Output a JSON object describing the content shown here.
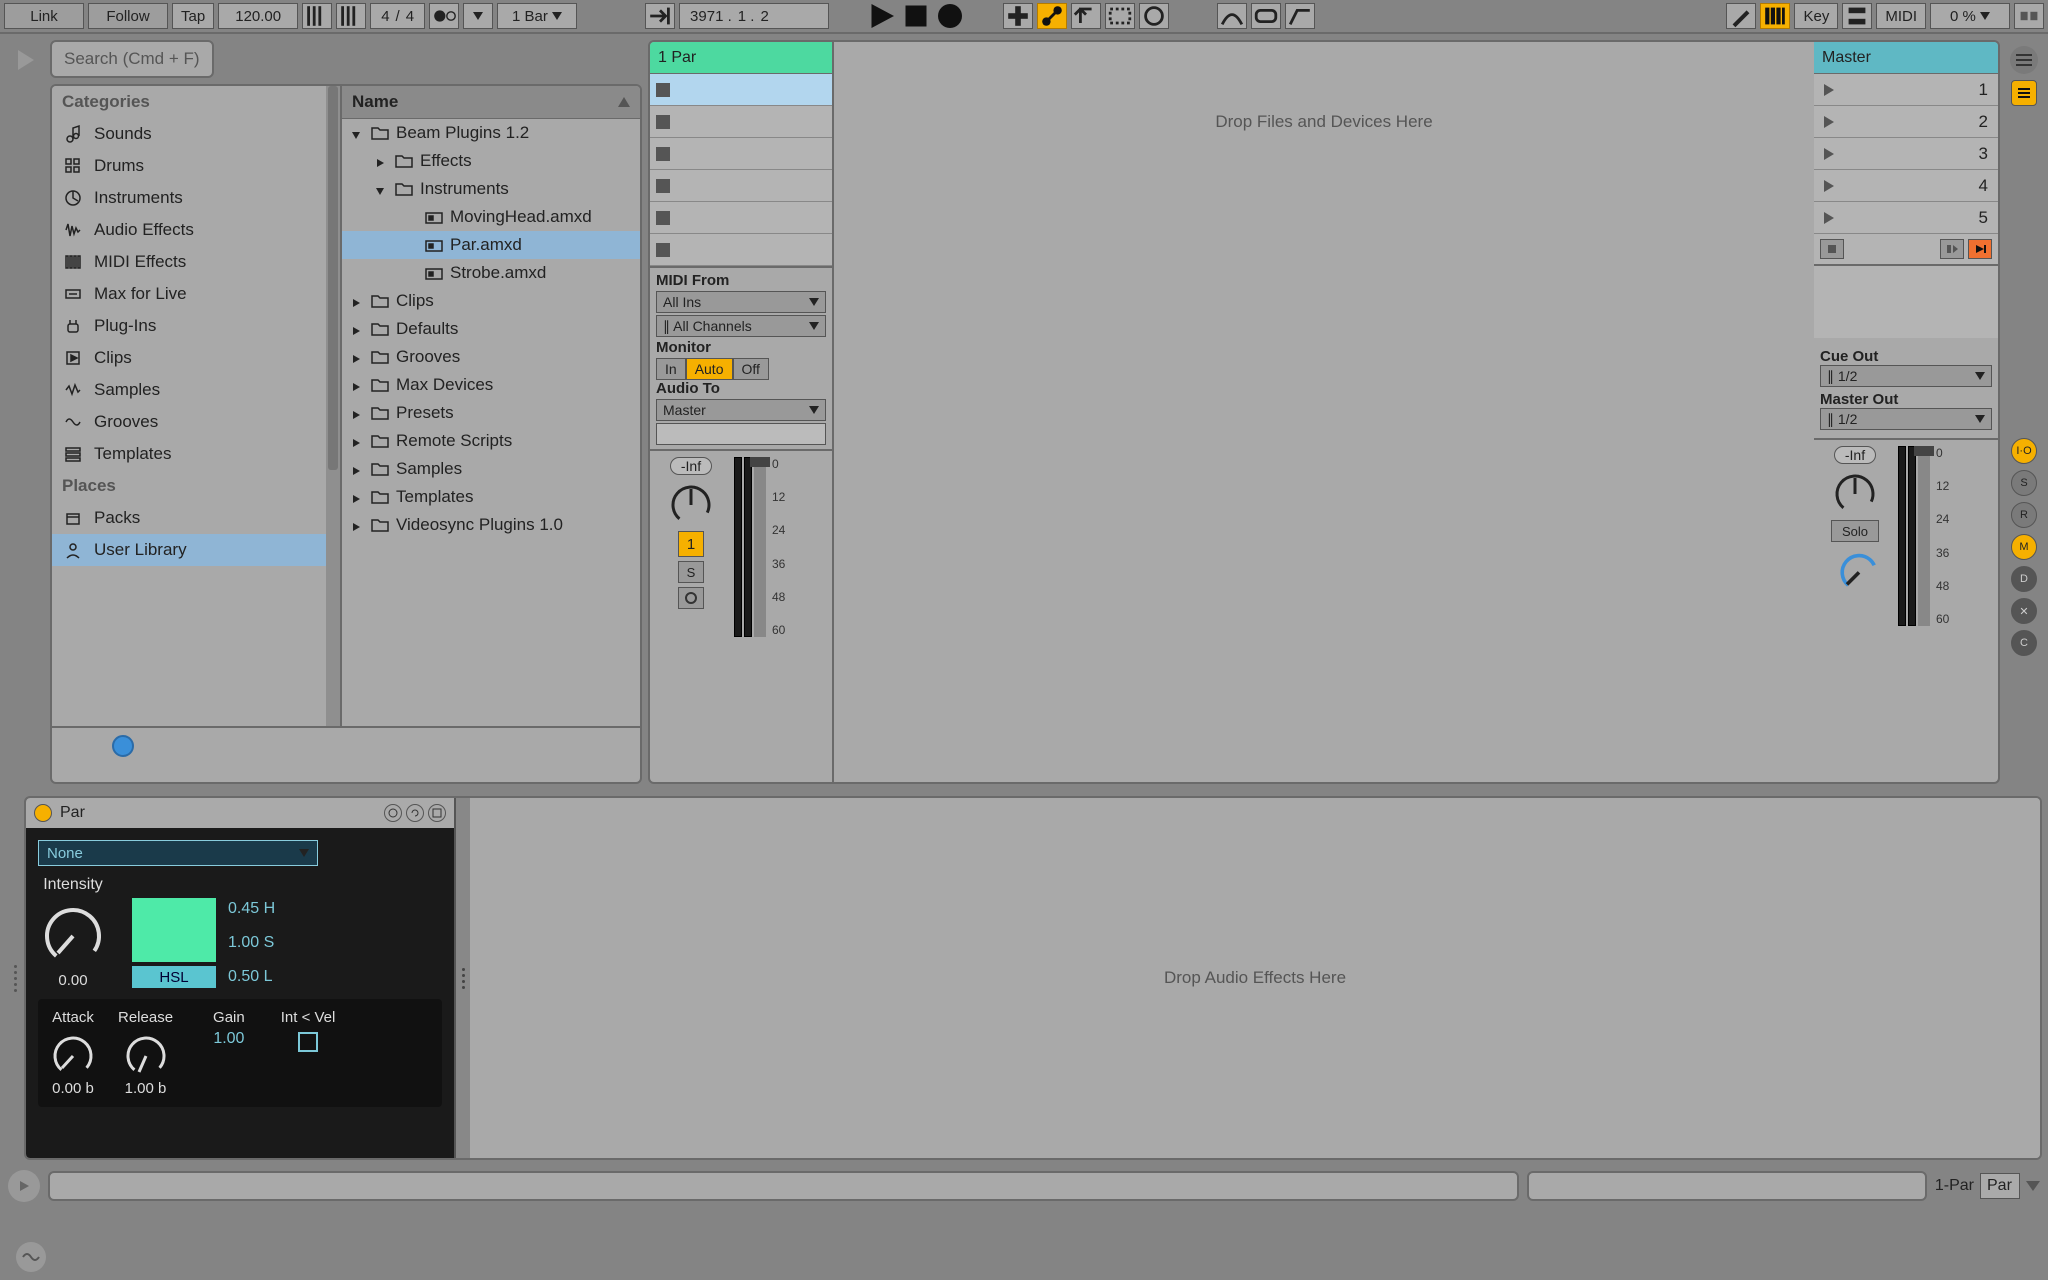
{
  "toolbar": {
    "link": "Link",
    "follow": "Follow",
    "tap": "Tap",
    "tempo": "120.00",
    "sig_num": "4",
    "sig_den": "4",
    "quantize": "1 Bar",
    "pos_bars": "3971 .",
    "pos_beats": "1 .",
    "pos_sixteenths": "2",
    "key": "Key",
    "midi": "MIDI",
    "cpu": "0 %"
  },
  "browser": {
    "search_placeholder": "Search (Cmd + F)",
    "cat_header": "Categories",
    "places_header": "Places",
    "categories": [
      "Sounds",
      "Drums",
      "Instruments",
      "Audio Effects",
      "MIDI Effects",
      "Max for Live",
      "Plug-Ins",
      "Clips",
      "Samples",
      "Grooves",
      "Templates"
    ],
    "places": [
      "Packs",
      "User Library"
    ],
    "name_header": "Name",
    "tree": {
      "root": "Beam Plugins 1.2",
      "effects": "Effects",
      "instruments": "Instruments",
      "inst_items": [
        "MovingHead.amxd",
        "Par.amxd",
        "Strobe.amxd"
      ],
      "folders": [
        "Clips",
        "Defaults",
        "Grooves",
        "Max Devices",
        "Presets",
        "Remote Scripts",
        "Samples",
        "Templates",
        "Videosync Plugins 1.0"
      ]
    }
  },
  "session": {
    "track_name": "1 Par",
    "drop_hint": "Drop Files and Devices Here",
    "midi_from": "MIDI From",
    "all_ins": "All Ins",
    "all_channels": "All Channels",
    "monitor": "Monitor",
    "mon_in": "In",
    "mon_auto": "Auto",
    "mon_off": "Off",
    "audio_to": "Audio To",
    "audio_to_val": "Master",
    "track_vol": "-Inf",
    "track_num": "1",
    "solo": "S",
    "scale": [
      "0",
      "12",
      "24",
      "36",
      "48",
      "60"
    ]
  },
  "master": {
    "name": "Master",
    "scenes": [
      "1",
      "2",
      "3",
      "4",
      "5"
    ],
    "cue_out": "Cue Out",
    "cue_val": "1/2",
    "master_out": "Master Out",
    "master_val": "1/2",
    "vol": "-Inf",
    "solo": "Solo"
  },
  "rail": {
    "io": "I·O",
    "s": "S",
    "r": "R",
    "m": "M",
    "d": "D",
    "x": "✕",
    "c": "C"
  },
  "device": {
    "title": "Par",
    "none": "None",
    "intensity": "Intensity",
    "intensity_val": "0.00",
    "hsl": "HSL",
    "h": "0.45 H",
    "s": "1.00 S",
    "l": "0.50 L",
    "attack": "Attack",
    "attack_val": "0.00 b",
    "release": "Release",
    "release_val": "1.00 b",
    "gain": "Gain",
    "gain_val": "1.00",
    "intvel": "Int < Vel",
    "fx_drop": "Drop Audio Effects Here"
  },
  "status": {
    "track_label": "1-Par",
    "clip_label": "Par"
  }
}
